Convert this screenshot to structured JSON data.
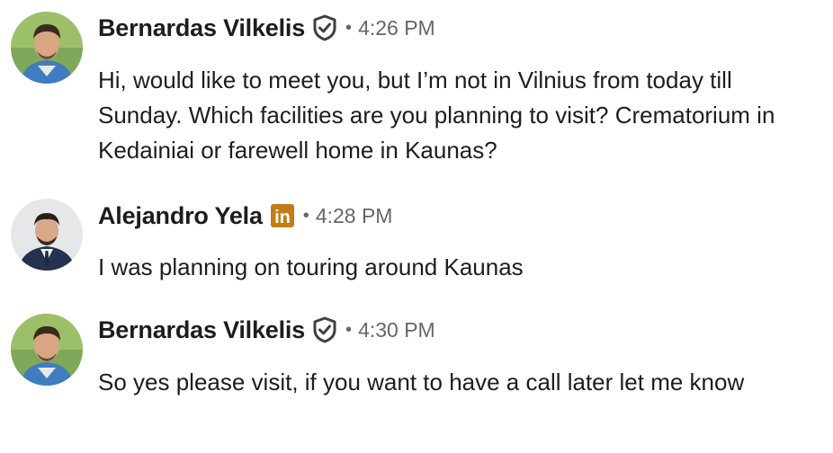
{
  "messages": [
    {
      "sender": "Bernardas Vilkelis",
      "badge": "verified-shield-icon",
      "separator": "•",
      "time": "4:26 PM",
      "text": "Hi, would like to meet you, but I’m not in Vilnius from today till Sunday. Which facilities are you planning to visit? Crematorium in Kedainiai or farewell home in Kaunas?"
    },
    {
      "sender": "Alejandro Yela",
      "badge": "linkedin-premium-icon",
      "badge_text": "in",
      "separator": "•",
      "time": "4:28 PM",
      "text": "I was planning on touring around Kaunas"
    },
    {
      "sender": "Bernardas Vilkelis",
      "badge": "verified-shield-icon",
      "separator": "•",
      "time": "4:30 PM",
      "text": "So yes please visit, if you want to have a call later let me know"
    }
  ],
  "colors": {
    "text": "#1d1d1d",
    "muted": "#666666",
    "premium_gold": "#c37d16",
    "shield": "#404040"
  }
}
